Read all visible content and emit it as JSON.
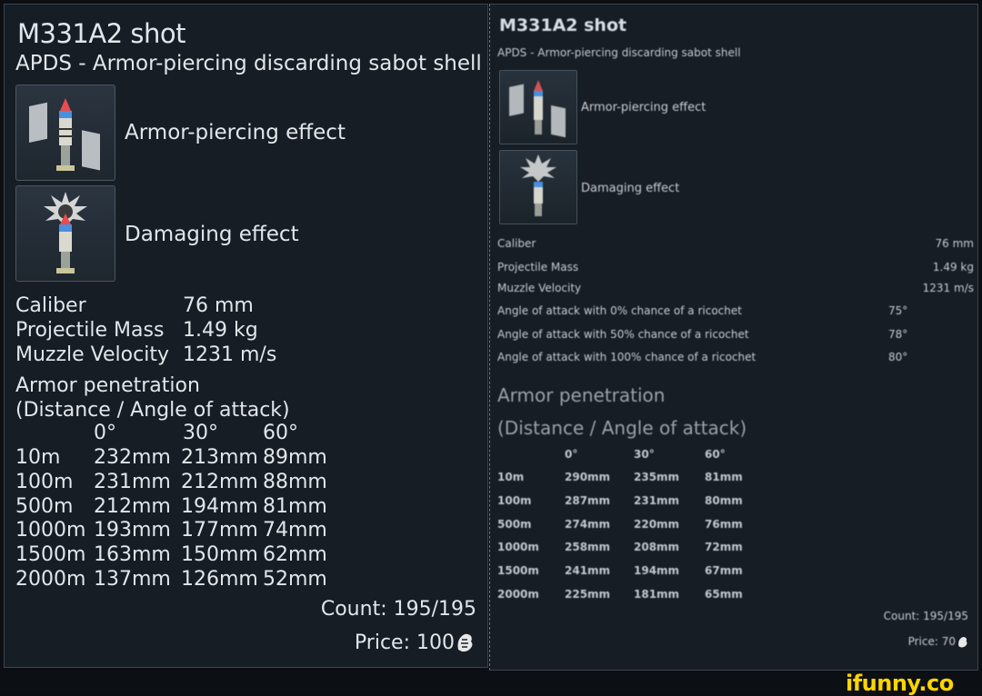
{
  "left": {
    "title": "M331A2 shot",
    "subtitle": "APDS - Armor-piercing discarding sabot shell",
    "effects": [
      "Armor-piercing effect",
      "Damaging effect"
    ],
    "stats": [
      {
        "label": "Caliber",
        "value": "76 mm"
      },
      {
        "label": "Projectile Mass",
        "value": "1.49 kg"
      },
      {
        "label": "Muzzle Velocity",
        "value": "1231 m/s"
      }
    ],
    "penetration_title": "Armor penetration",
    "penetration_subtitle": "(Distance / Angle of attack)",
    "angles": [
      "0°",
      "30°",
      "60°"
    ],
    "rows": [
      [
        "10m",
        "232mm",
        "213mm",
        "89mm"
      ],
      [
        "100m",
        "231mm",
        "212mm",
        "88mm"
      ],
      [
        "500m",
        "212mm",
        "194mm",
        "81mm"
      ],
      [
        "1000m",
        "193mm",
        "177mm",
        "74mm"
      ],
      [
        "1500m",
        "163mm",
        "150mm",
        "62mm"
      ],
      [
        "2000m",
        "137mm",
        "126mm",
        "52mm"
      ]
    ],
    "count": "Count: 195/195",
    "price": "Price: 100"
  },
  "right": {
    "title": "M331A2 shot",
    "subtitle": "APDS - Armor-piercing discarding sabot shell",
    "effects": [
      "Armor-piercing effect",
      "Damaging effect"
    ],
    "stats": [
      {
        "label": "Caliber",
        "value": "76 mm"
      },
      {
        "label": "Projectile Mass",
        "value": "1.49 kg"
      },
      {
        "label": "Muzzle Velocity",
        "value": "1231 m/s"
      },
      {
        "label": "Angle of attack with 0% chance of a ricochet",
        "value": "75°"
      },
      {
        "label": "Angle of attack with 50% chance of a ricochet",
        "value": "78°"
      },
      {
        "label": "Angle of attack with 100% chance of a ricochet",
        "value": "80°"
      }
    ],
    "penetration_title": "Armor penetration",
    "penetration_subtitle": "(Distance / Angle of attack)",
    "angles": [
      "0°",
      "30°",
      "60°"
    ],
    "rows": [
      [
        "10m",
        "290mm",
        "235mm",
        "81mm"
      ],
      [
        "100m",
        "287mm",
        "231mm",
        "80mm"
      ],
      [
        "500m",
        "274mm",
        "220mm",
        "76mm"
      ],
      [
        "1000m",
        "258mm",
        "208mm",
        "72mm"
      ],
      [
        "1500m",
        "241mm",
        "194mm",
        "67mm"
      ],
      [
        "2000m",
        "225mm",
        "181mm",
        "65mm"
      ]
    ],
    "count": "Count: 195/195",
    "price": "Price: 70"
  },
  "watermark": "ifunny.co",
  "icons": {
    "armor_piercing": "ap-shell-icon",
    "damaging": "he-burst-icon",
    "currency": "silver-lion-icon"
  },
  "colors": {
    "panel_bg": "#161d24",
    "text": "#e2e6ea",
    "watermark": "#ffd400"
  }
}
